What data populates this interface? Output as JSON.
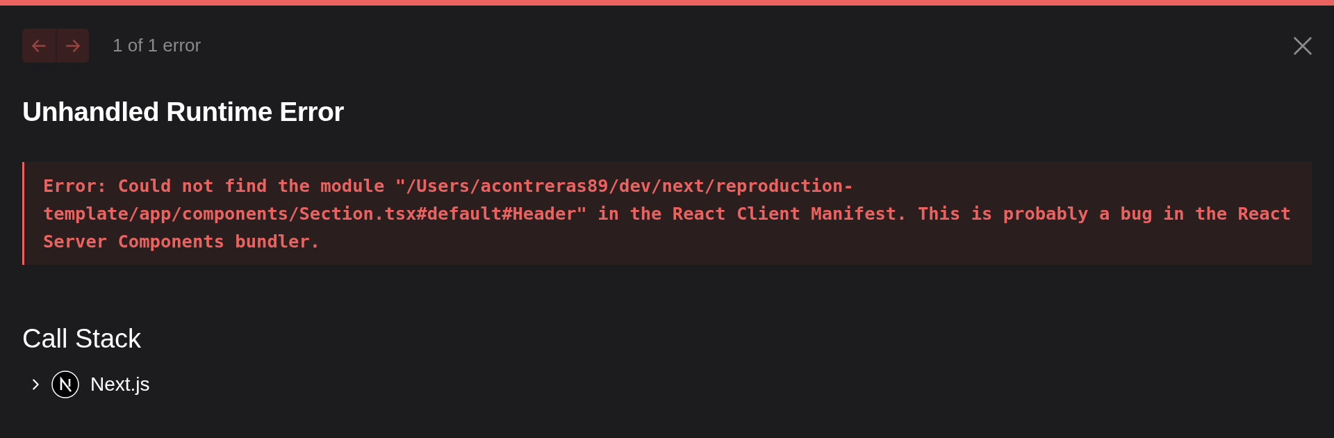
{
  "nav": {
    "buttons": [
      {
        "kind": "previous",
        "disabled": true
      },
      {
        "kind": "next",
        "disabled": true
      }
    ],
    "counter": "1 of 1 error"
  },
  "title": "Unhandled Runtime Error",
  "error_message": "Error: Could not find the module \"/Users/acontreras89/dev/next/reproduction-template/app/components/Section.tsx#default#Header\" in the React Client Manifest. This is probably a bug in the React Server Components bundler.",
  "call_stack": {
    "heading": "Call Stack",
    "frames": [
      {
        "label": "Next.js",
        "expanded": false
      }
    ]
  }
}
